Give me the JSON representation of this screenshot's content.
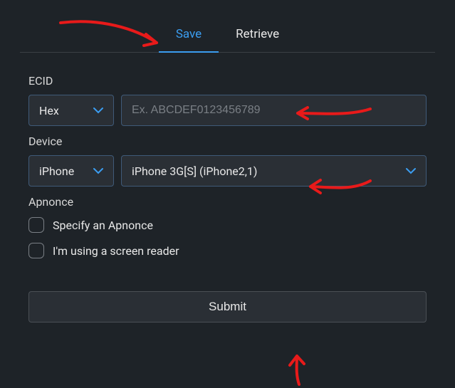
{
  "tabs": {
    "save": "Save",
    "retrieve": "Retrieve"
  },
  "ecid": {
    "label": "ECID",
    "format": "Hex",
    "placeholder": "Ex. ABCDEF0123456789"
  },
  "device": {
    "label": "Device",
    "type": "iPhone",
    "model": "iPhone 3G[S] (iPhone2,1)"
  },
  "apnonce": {
    "label": "Apnonce",
    "specify": "Specify an Apnonce"
  },
  "screenreader": "I'm using a screen reader",
  "submit": "Submit",
  "annotations": {
    "color": "#e81a1a"
  }
}
